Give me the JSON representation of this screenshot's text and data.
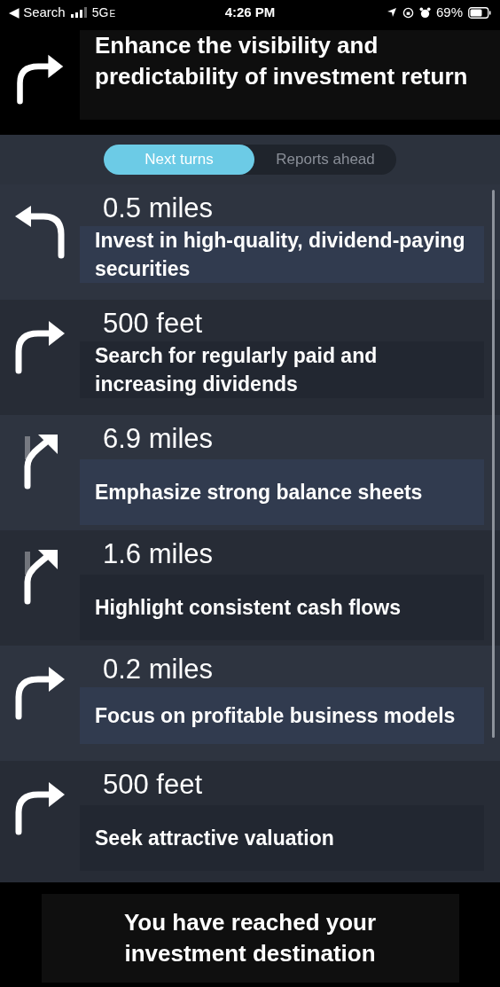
{
  "status_bar": {
    "back_label": "◀ Search",
    "network": "5G",
    "network_suffix": "E",
    "time": "4:26 PM",
    "battery": "69%"
  },
  "current_instruction": {
    "kind": "right",
    "text": "Enhance the visibility and predictability of investment return"
  },
  "tabs": [
    {
      "label": "Next turns",
      "selected": true
    },
    {
      "label": "Reports ahead",
      "selected": false
    }
  ],
  "turns": [
    {
      "kind": "left",
      "distance": "0.5 miles",
      "text": "Invest in high-quality, dividend-paying securities"
    },
    {
      "kind": "right",
      "distance": "500 feet",
      "text": "Search for regularly paid and increasing dividends"
    },
    {
      "kind": "slight-right",
      "distance": "6.9 miles",
      "text": "Emphasize strong balance sheets"
    },
    {
      "kind": "slight-right",
      "distance": "1.6 miles",
      "text": "Highlight consistent cash flows"
    },
    {
      "kind": "right",
      "distance": "0.2 miles",
      "text": "Focus on profitable business models"
    },
    {
      "kind": "right",
      "distance": "500 feet",
      "text": "Seek attractive valuation"
    }
  ],
  "destination": {
    "text": "You have reached your investment destination"
  }
}
